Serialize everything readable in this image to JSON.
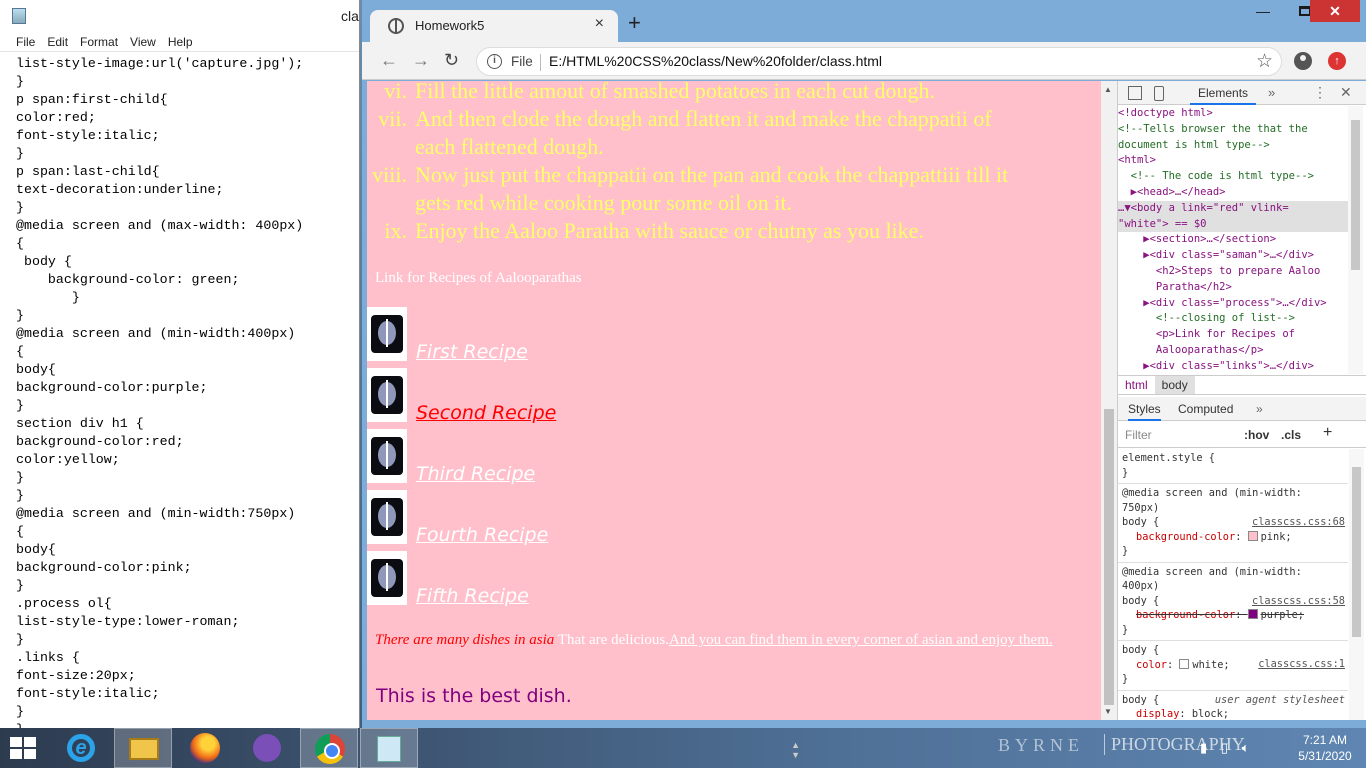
{
  "notepad": {
    "title": "cla",
    "menu": [
      "File",
      "Edit",
      "Format",
      "View",
      "Help"
    ],
    "lines": [
      "list-style-image:url('capture.jpg');",
      "}",
      "p span:first-child{",
      "color:red;",
      "font-style:italic;",
      "}",
      "p span:last-child{",
      "text-decoration:underline;",
      "}",
      "@media screen and (max-width: 400px)",
      "{",
      " body {",
      "    background-color: green;",
      "       }",
      "}",
      "@media screen and (min-width:400px)",
      "{",
      "body{",
      "background-color:purple;",
      "}",
      "section div h1 {",
      "background-color:red;",
      "color:yellow;",
      "}",
      "}",
      "@media screen and (min-width:750px)",
      "{",
      "body{",
      "background-color:pink;",
      "}",
      ".process ol{",
      "list-style-type:lower-roman;",
      "}",
      ".links {",
      "font-size:20px;",
      "font-style:italic;",
      "}",
      "}"
    ]
  },
  "browser": {
    "tab_title": "Homework5",
    "close_tab": "×",
    "new_tab": "+",
    "window_min": "—",
    "window_close": "✕",
    "file_label": "File",
    "url": "E:/HTML%20CSS%20class/New%20folder/class.html",
    "update_badge": "↑"
  },
  "page": {
    "list_items": [
      {
        "num": "vi.",
        "lines": [
          "Fill the little amout of smashed potatoes in each cut dough."
        ]
      },
      {
        "num": "vii.",
        "lines": [
          "And then clode the dough and flatten it and make the chappatii of",
          "each flattened dough."
        ]
      },
      {
        "num": "viii.",
        "lines": [
          "Now just put the chappatii on the pan and cook the chappattiii till it",
          "gets red while cooking pour some oil on it."
        ]
      },
      {
        "num": "ix.",
        "lines": [
          "Enjoy the Aaloo Paratha with sauce or chutny as you like."
        ]
      }
    ],
    "links_heading": "Link for Recipes of Aalooparathas",
    "recipes": [
      "First Recipe",
      "Second Recipe",
      "Third Recipe",
      "Fourth Recipe",
      "Fifth Recipe"
    ],
    "footer": {
      "red_part": "There are many dishes in asia",
      "mid_part": " That are delicious.",
      "underlined_part": "And you can find them in every corner of asian and enjoy them."
    },
    "best_dish": "This is the best dish.",
    "colors": {
      "bg": "#ffc0cb",
      "list_text": "#ffff66",
      "visited_link": "#ff0000",
      "link": "#ffffff",
      "best": "#800080"
    }
  },
  "devtools": {
    "main_tab": "Elements",
    "elements": [
      "<!doctype html>",
      "<!--Tells browser the that the",
      "document is html type-->",
      "<html>",
      "  <!-- The code is html type-->",
      "  ▶<head>…</head>",
      "…▼<body a link=\"red\" vlink=",
      "\"white\"> == $0",
      "    ▶<section>…</section>",
      "    ▶<div class=\"saman\">…</div>",
      "      <h2>Steps to prepare Aaloo",
      "      Paratha</h2>",
      "    ▶<div class=\"process\">…</div>",
      "      <!--closing of list-->",
      "      <p>Link for Recipes of",
      "      Aalooparathas</p>",
      "    ▶<div class=\"links\">…</div>"
    ],
    "breadcrumbs": [
      "html",
      "body"
    ],
    "styles_tabs": [
      "Styles",
      "Computed"
    ],
    "filter_placeholder": "Filter",
    "hov": ":hov",
    "cls": ".cls",
    "plus": "+",
    "rules": [
      {
        "media": "",
        "selector": "element.style {",
        "source": "",
        "props": []
      },
      {
        "media": "@media screen and (min-width:\n750px)",
        "selector": "body {",
        "source": "classcss.css:68",
        "props": [
          {
            "name": "background-color",
            "value": "pink;",
            "swatch": "#ffc0cb",
            "struck": false
          }
        ]
      },
      {
        "media": "@media screen and (min-width:\n400px)",
        "selector": "body {",
        "source": "classcss.css:58",
        "props": [
          {
            "name": "background-color",
            "value": "purple;",
            "swatch": "#800080",
            "struck": true
          }
        ]
      },
      {
        "media": "",
        "selector": "body {",
        "source": "classcss.css:1",
        "props": [
          {
            "name": "color",
            "value": "white;",
            "swatch": "#ffffff",
            "struck": false
          }
        ]
      },
      {
        "media": "",
        "selector": "body {",
        "source": "user agent stylesheet",
        "props": [
          {
            "name": "display",
            "value": "block;",
            "swatch": "",
            "struck": false
          }
        ]
      }
    ]
  },
  "taskbar": {
    "brand_left": "BYRNE",
    "brand_right": "PHOTOGRAPHY",
    "time": "7:21 AM",
    "date": "5/31/2020"
  }
}
